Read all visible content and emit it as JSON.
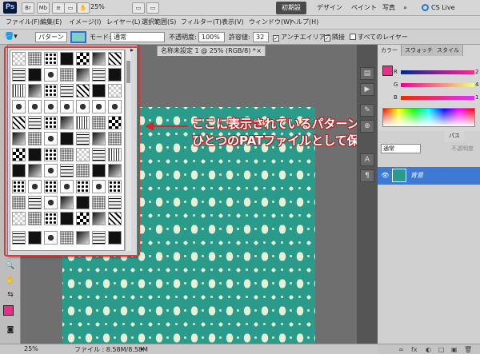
{
  "appbar": {
    "logo": "Ps",
    "icons": [
      "Br",
      "Mb",
      "≡",
      "▭",
      "✋",
      "🔍"
    ],
    "zoom": "25%",
    "workspaces": [
      "初期設定",
      "デザイン",
      "ペイント",
      "写真"
    ],
    "more": "»",
    "cs_live": "CS Live",
    "window_controls": [
      "–",
      "□",
      "×"
    ]
  },
  "menubar": {
    "items": [
      "ファイル(F)",
      "編集(E)",
      "イメージ(I)",
      "レイヤー(L)",
      "選択範囲(S)",
      "フィルター(T)",
      "表示(V)",
      "ウィンドウ(W)",
      "ヘルプ(H)"
    ]
  },
  "options": {
    "fill_source": "パターン",
    "mode_label": "モード:",
    "mode_value": "通常",
    "opacity_label": "不透明度:",
    "opacity_value": "100%",
    "tolerance_label": "許容値:",
    "tolerance_value": "32",
    "antialias_label": "アンチエイリアス",
    "contiguous_label": "隣接",
    "all_layers_label": "すべてのレイヤー",
    "check_mark": "✓"
  },
  "document": {
    "tab_title": "名称未設定 1 @ 25% (RGB/8) *",
    "tab_close": "×"
  },
  "callout": {
    "line1": "ここに表示されているパターンすべてが",
    "line2": "ひとつのPATファイルとして保存されます。"
  },
  "color_panel": {
    "tabs": [
      "カラー",
      "スウォッチ",
      "スタイル"
    ],
    "channels": [
      {
        "label": "R",
        "value": "2"
      },
      {
        "label": "G",
        "value": "4"
      },
      {
        "label": "B",
        "value": "1"
      }
    ],
    "foreground_color": "#ee2a8a"
  },
  "layers_panel": {
    "tab": "パス",
    "blend_mode": "通常",
    "opacity_label": "不透明度",
    "layer_name": "背景",
    "eye": "👁",
    "footer_icons": [
      "∞",
      "fx",
      "◐",
      "□",
      "▣",
      "🗑"
    ]
  },
  "toolbar": {
    "tools": [
      "▭",
      "◌",
      "✂",
      "✎",
      "⌂",
      "⚲",
      "T",
      "↖",
      "◇",
      "✋",
      "🔍"
    ]
  },
  "status": {
    "zoom": "25%",
    "file_info": "ファイル : 8.58M/8.58M",
    "arrow": "▸"
  },
  "accent_colors": {
    "highlight": "#d73a3a",
    "callout_stroke": "#c01818",
    "canvas_pattern": "#2a9a8b"
  }
}
